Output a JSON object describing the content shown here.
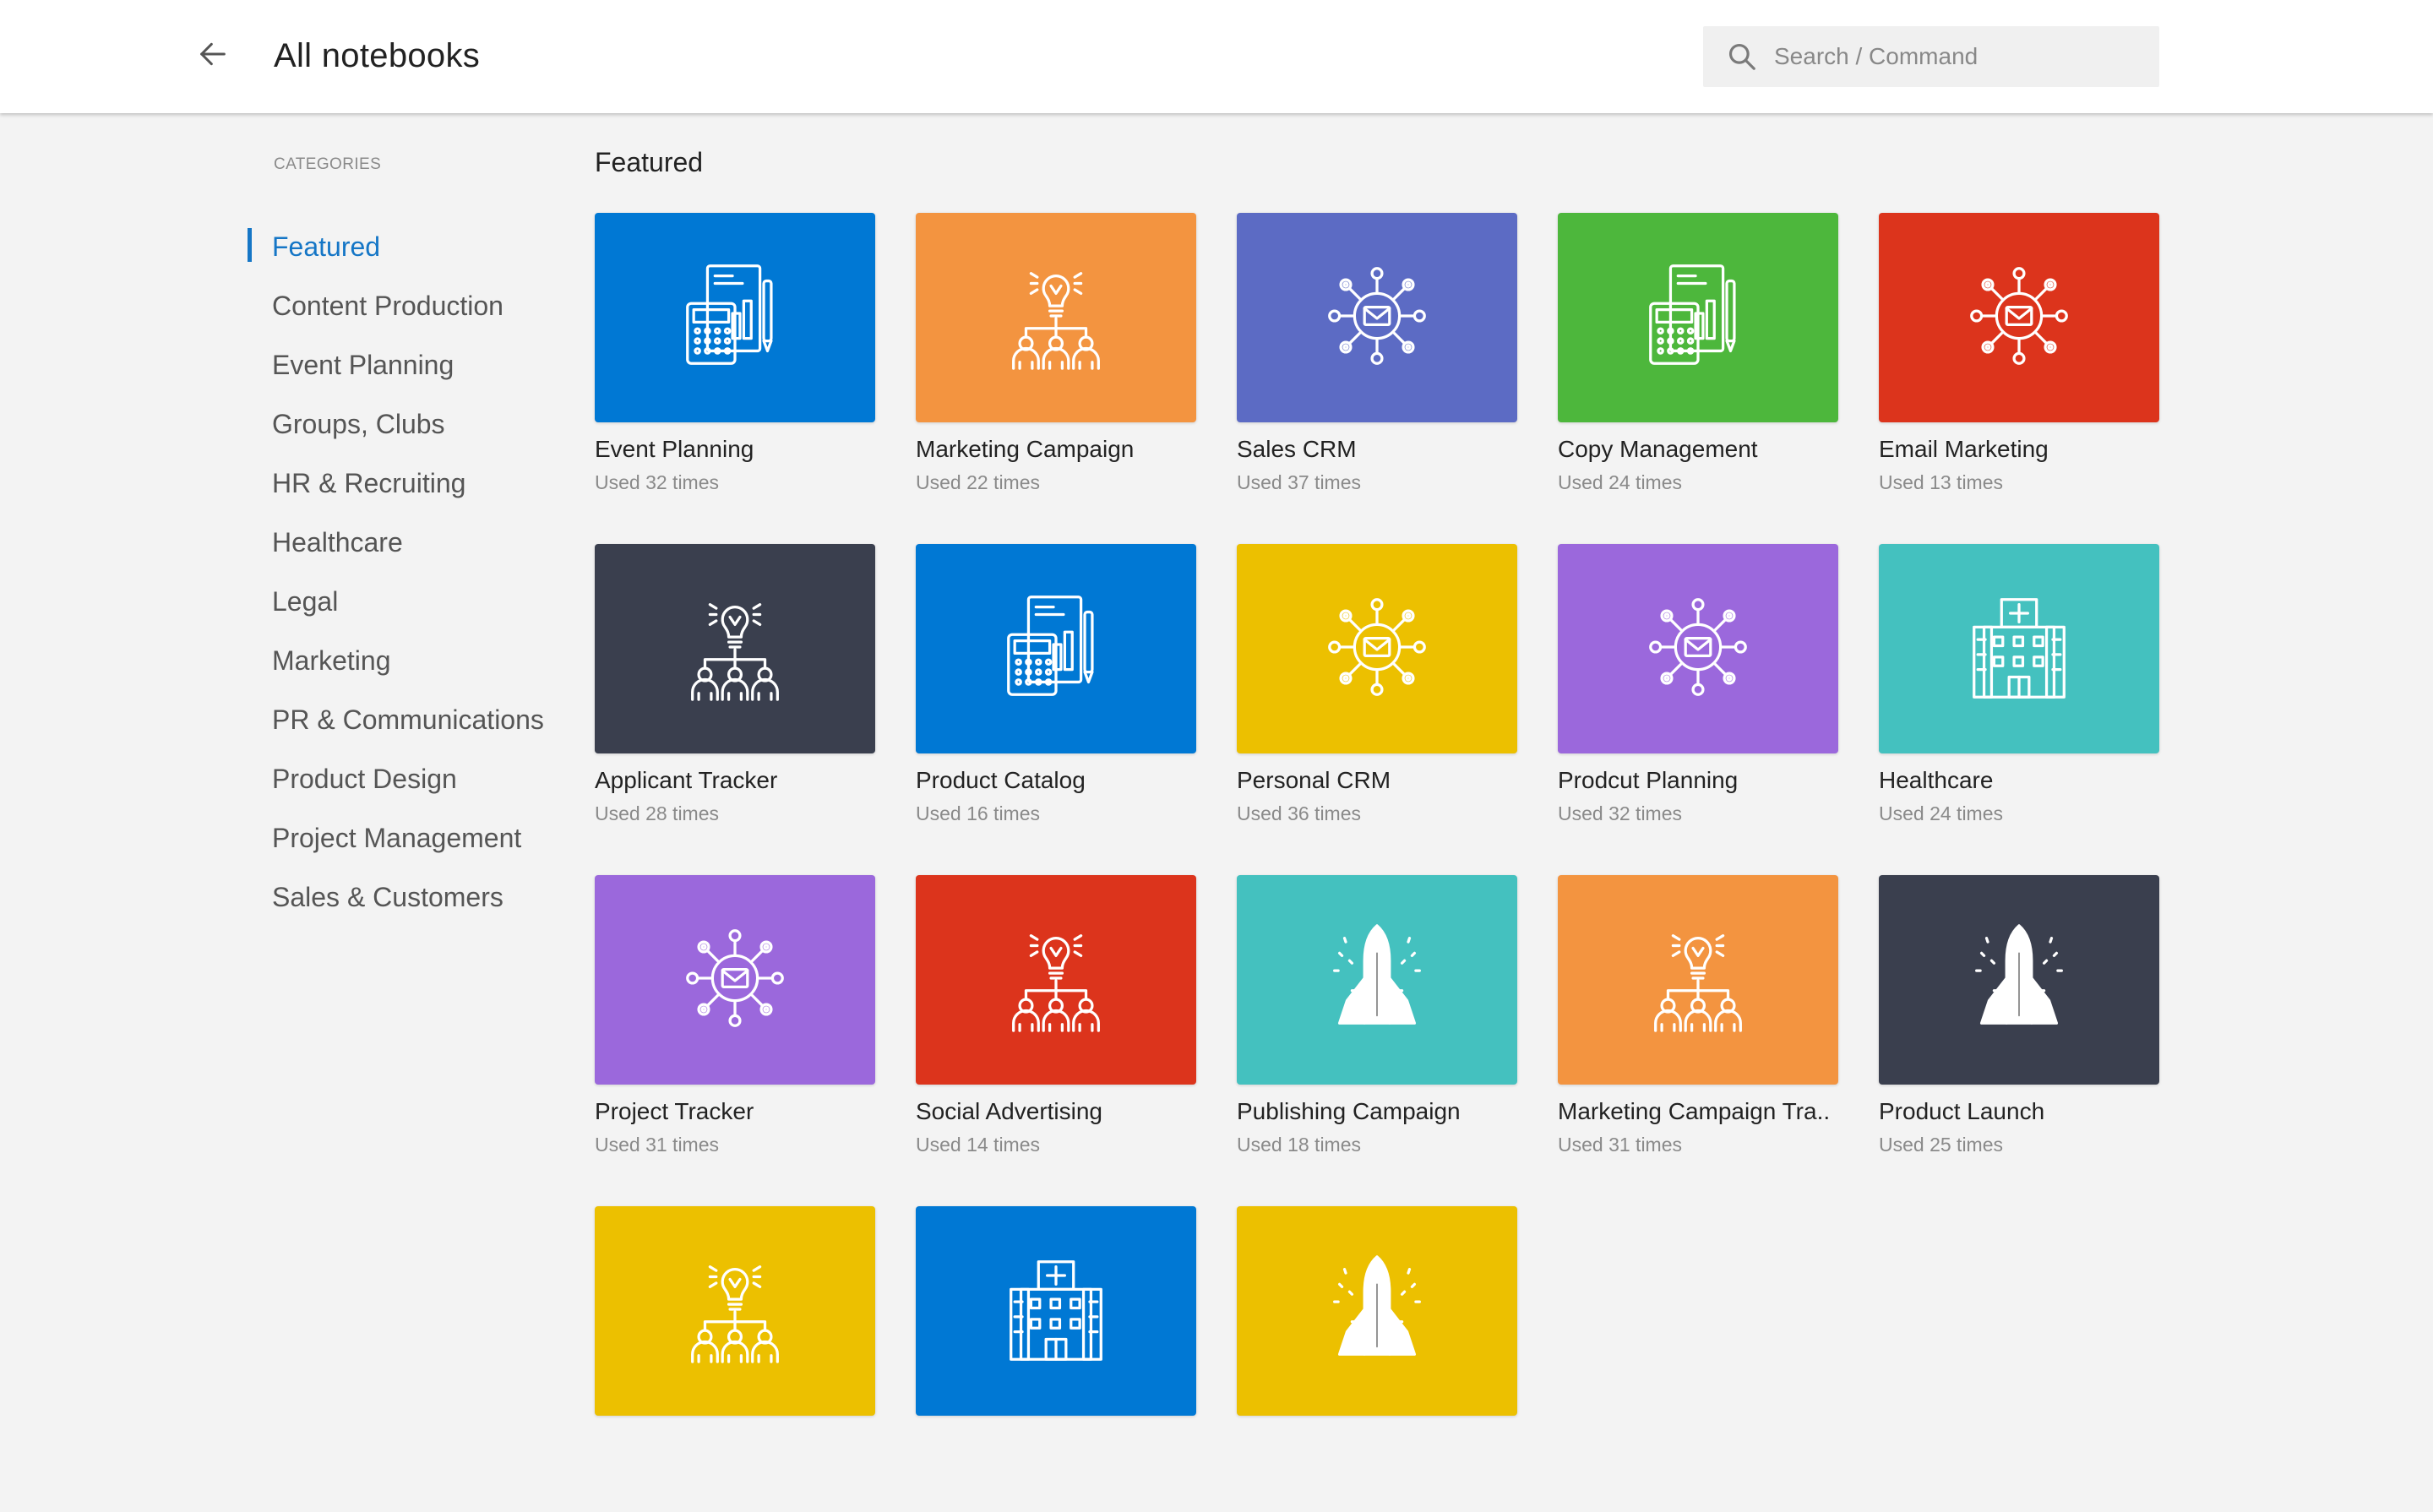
{
  "header": {
    "title": "All notebooks",
    "back_icon": "arrow-left-icon",
    "search_placeholder": "Search / Command",
    "search_value": ""
  },
  "sidebar": {
    "heading": "CATEGORIES",
    "items": [
      {
        "label": "Featured",
        "active": true
      },
      {
        "label": "Content Production"
      },
      {
        "label": "Event Planning"
      },
      {
        "label": "Groups, Clubs"
      },
      {
        "label": "HR & Recruiting"
      },
      {
        "label": "Healthcare"
      },
      {
        "label": "Legal"
      },
      {
        "label": "Marketing"
      },
      {
        "label": "PR & Communications"
      },
      {
        "label": "Product Design"
      },
      {
        "label": "Project Management"
      },
      {
        "label": "Sales & Customers"
      }
    ]
  },
  "main": {
    "section_title": "Featured",
    "cards": [
      {
        "name": "Event Planning",
        "usage": "Used 32 times",
        "color": "#0078d4",
        "icon": "calculator-report-icon"
      },
      {
        "name": "Marketing Campaign",
        "usage": "Used 22 times",
        "color": "#f39440",
        "icon": "idea-team-icon"
      },
      {
        "name": "Sales CRM",
        "usage": "Used 37 times",
        "color": "#5c6bc4",
        "icon": "email-network-icon"
      },
      {
        "name": "Copy Management",
        "usage": "Used 24 times",
        "color": "#4db73c",
        "icon": "calculator-report-icon"
      },
      {
        "name": "Email Marketing",
        "usage": "Used 13 times",
        "color": "#dc341c",
        "icon": "email-network-icon"
      },
      {
        "name": "Applicant Tracker",
        "usage": "Used 28 times",
        "color": "#3a3f4e",
        "icon": "idea-team-icon"
      },
      {
        "name": "Product Catalog",
        "usage": "Used 16 times",
        "color": "#0078d4",
        "icon": "calculator-report-icon"
      },
      {
        "name": "Personal CRM",
        "usage": "Used 36 times",
        "color": "#ecc000",
        "icon": "email-network-icon"
      },
      {
        "name": "Prodcut Planning",
        "usage": "Used 32 times",
        "color": "#9b68dc",
        "icon": "email-network-icon"
      },
      {
        "name": "Healthcare",
        "usage": "Used 24 times",
        "color": "#44c1bf",
        "icon": "hospital-icon"
      },
      {
        "name": "Project Tracker",
        "usage": "Used 31 times",
        "color": "#9b68dc",
        "icon": "email-network-icon"
      },
      {
        "name": "Social Advertising",
        "usage": "Used 14 times",
        "color": "#dc341c",
        "icon": "idea-team-icon"
      },
      {
        "name": "Publishing Campaign",
        "usage": "Used 18 times",
        "color": "#44c1bf",
        "icon": "rocket-icon"
      },
      {
        "name": "Marketing Campaign Tra..",
        "usage": "Used 31 times",
        "color": "#f39440",
        "icon": "idea-team-icon"
      },
      {
        "name": "Product Launch",
        "usage": "Used 25 times",
        "color": "#3a3f4e",
        "icon": "rocket-icon"
      },
      {
        "name": "",
        "usage": "",
        "color": "#ecc000",
        "icon": "idea-team-icon"
      },
      {
        "name": "",
        "usage": "",
        "color": "#0078d4",
        "icon": "hospital-icon"
      },
      {
        "name": "",
        "usage": "",
        "color": "#ecc000",
        "icon": "rocket-icon"
      }
    ]
  }
}
